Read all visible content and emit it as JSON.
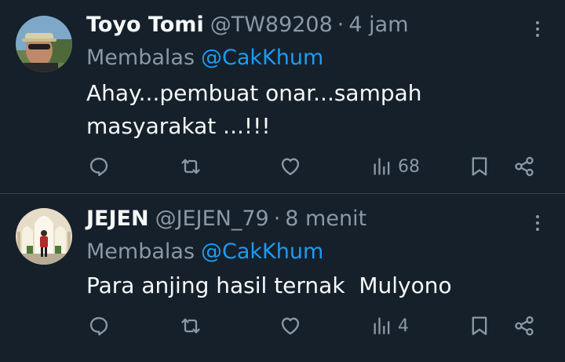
{
  "tweets": [
    {
      "name": "Toyo Tomi",
      "handle": "@TW89208",
      "separator": "·",
      "time": "4 jam",
      "reply_prefix": "Membalas",
      "reply_mention": "@CakKhum",
      "text_lines": [
        "Ahay...pembuat onar...sampah",
        "masyarakat ...!!!"
      ],
      "views": "68"
    },
    {
      "name": "JEJEN",
      "handle": "@JEJEN_79",
      "separator": "·",
      "time": "8 menit",
      "reply_prefix": "Membalas",
      "reply_mention": "@CakKhum",
      "text_lines": [
        "Para anjing hasil ternak  Mulyono"
      ],
      "views": "4"
    }
  ],
  "icons": {
    "reply": "reply-icon",
    "retweet": "retweet-icon",
    "like": "heart-icon",
    "views": "views-icon",
    "bookmark": "bookmark-icon",
    "share": "share-icon",
    "more": "more-icon"
  },
  "colors": {
    "background": "#15202b",
    "text": "#f7f9f9",
    "muted": "#8b98a5",
    "accent": "#1d9bf0",
    "divider": "#38444d"
  }
}
